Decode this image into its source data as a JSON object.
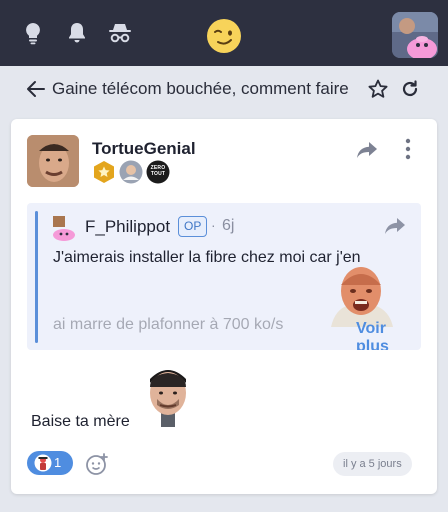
{
  "header": {
    "icons": [
      "lightbulb-icon",
      "bell-icon",
      "incognito-icon"
    ],
    "logo": "smiling-face-logo",
    "accent": "#2d3040"
  },
  "thread": {
    "back_icon": "arrow-left-icon",
    "title": "Gaine télécom bouchée, comment faire",
    "actions": [
      "star-icon",
      "refresh-icon"
    ]
  },
  "post": {
    "author": "TortueGenial",
    "badges": [
      "gold-star-badge",
      "person-badge",
      "zero-tout-badge"
    ],
    "badge_zero_text": "ZERO TOUT",
    "quote": {
      "author": "F_Philippot",
      "op_label": "OP",
      "separator": "·",
      "age": "6j",
      "line1": "J'aimerais installer la fibre chez moi car j'en",
      "line2": "ai marre de plafonner à 700 ko/s",
      "read_more": "Voir plus"
    },
    "body": "Baise ta mère",
    "reaction_count": "1",
    "timestamp": "il y a 5 jours",
    "colors": {
      "link": "#4f8de0",
      "reaction": "#4f8de0"
    }
  }
}
